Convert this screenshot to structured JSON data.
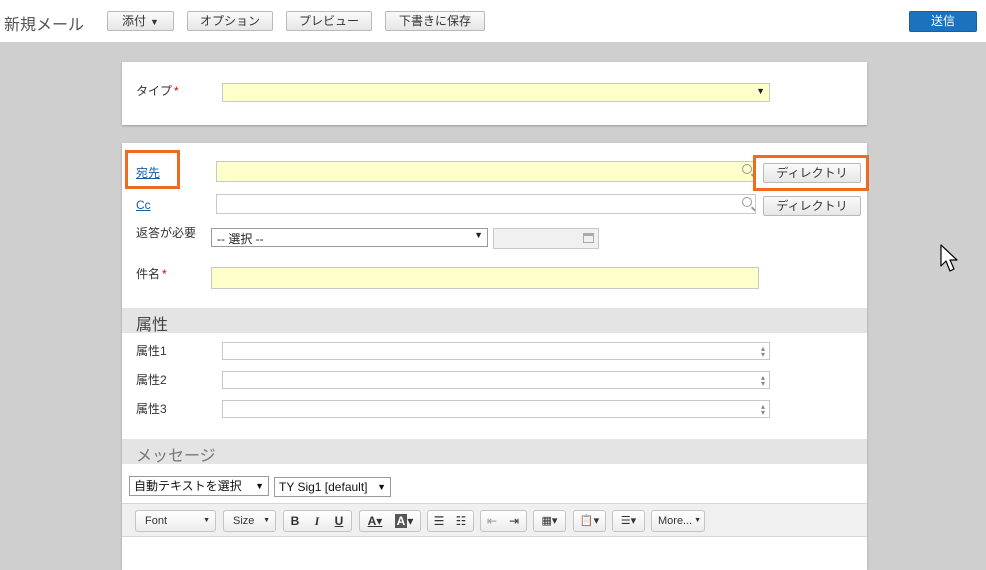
{
  "header": {
    "title": "新規メール",
    "attach_label": "添付",
    "options_label": "オプション",
    "preview_label": "プレビュー",
    "save_draft_label": "下書きに保存",
    "send_label": "送信"
  },
  "type_section": {
    "type_label": "タイプ",
    "required_mark": "*"
  },
  "recipients": {
    "to_label": "宛先",
    "cc_label": "Cc",
    "directory_label": "ディレクトリ",
    "reply_required_label": "返答が必要",
    "reply_select_value": "-- 選択 --",
    "subject_label": "件名",
    "required_mark": "*"
  },
  "attributes": {
    "section_title": "属性",
    "items": [
      {
        "label": "属性1"
      },
      {
        "label": "属性2"
      },
      {
        "label": "属性3"
      }
    ]
  },
  "message": {
    "section_title": "メッセージ",
    "auto_text_label": "自動テキストを選択",
    "signature_value": "TY Sig1 [default]"
  },
  "editor": {
    "font_label": "Font",
    "size_label": "Size",
    "bold": "B",
    "italic": "I",
    "underline": "U",
    "more_label": "More..."
  },
  "colors": {
    "accent": "#1b72be",
    "highlight": "#ef6b1f",
    "required_field_bg": "#ffffcc",
    "canvas_bg": "#cfcfcf"
  }
}
